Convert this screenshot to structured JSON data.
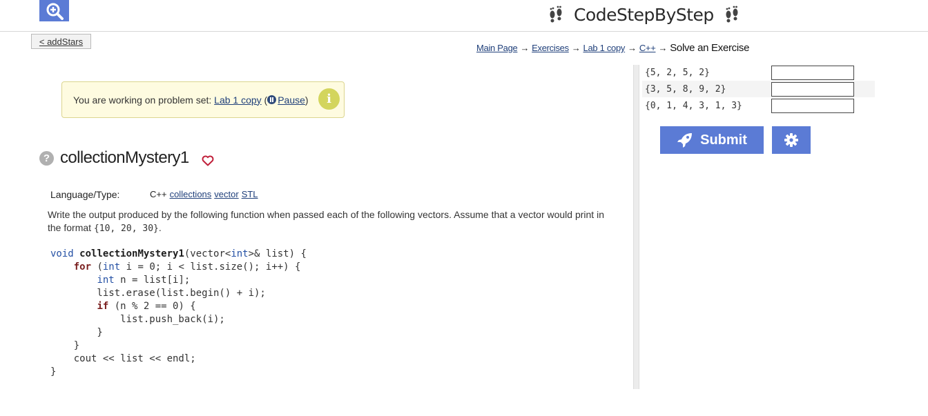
{
  "header": {
    "brand": "CodeStepByStep",
    "zoom_icon": "zoom-in-icon",
    "logo_icon": "footprints-icon"
  },
  "nav": {
    "back_label": "< addStars",
    "breadcrumb": {
      "main_page": "Main Page",
      "exercises": "Exercises",
      "lab": "Lab 1 copy",
      "cpp": "C++",
      "current": "Solve an Exercise",
      "arrow": "→"
    }
  },
  "notice": {
    "prefix": "You are working on problem set:",
    "set_name": "Lab 1 copy",
    "pause_label": "Pause",
    "info_symbol": "i"
  },
  "problem": {
    "help_symbol": "?",
    "title": "collectionMystery1",
    "language_label": "Language/Type:",
    "language": "C++",
    "tags": [
      "collections",
      "vector",
      "STL"
    ],
    "description_prefix": "Write the output produced by the following function when passed each of the following vectors. Assume that a vector would print in the format",
    "description_format": "{10, 20, 30}",
    "description_suffix": "."
  },
  "code_lines": [
    "void collectionMystery1(vector<int>& list) {",
    "    for (int i = 0; i < list.size(); i++) {",
    "        int n = list[i];",
    "        list.erase(list.begin() + i);",
    "        if (n % 2 == 0) {",
    "            list.push_back(i);",
    "        }",
    "    }",
    "    cout << list << endl;",
    "}"
  ],
  "answers": [
    {
      "prompt": "{5, 2, 5, 2}",
      "value": ""
    },
    {
      "prompt": "{3, 5, 8, 9, 2}",
      "value": ""
    },
    {
      "prompt": "{0, 1, 4, 3, 1, 3}",
      "value": ""
    }
  ],
  "actions": {
    "submit_label": "Submit",
    "submit_icon": "rocket-icon",
    "settings_icon": "gear-icon"
  },
  "colors": {
    "accent": "#5b7bd5",
    "notice_bg": "#fefbe0",
    "info": "#d3d55d",
    "link": "#1f3f7a"
  }
}
